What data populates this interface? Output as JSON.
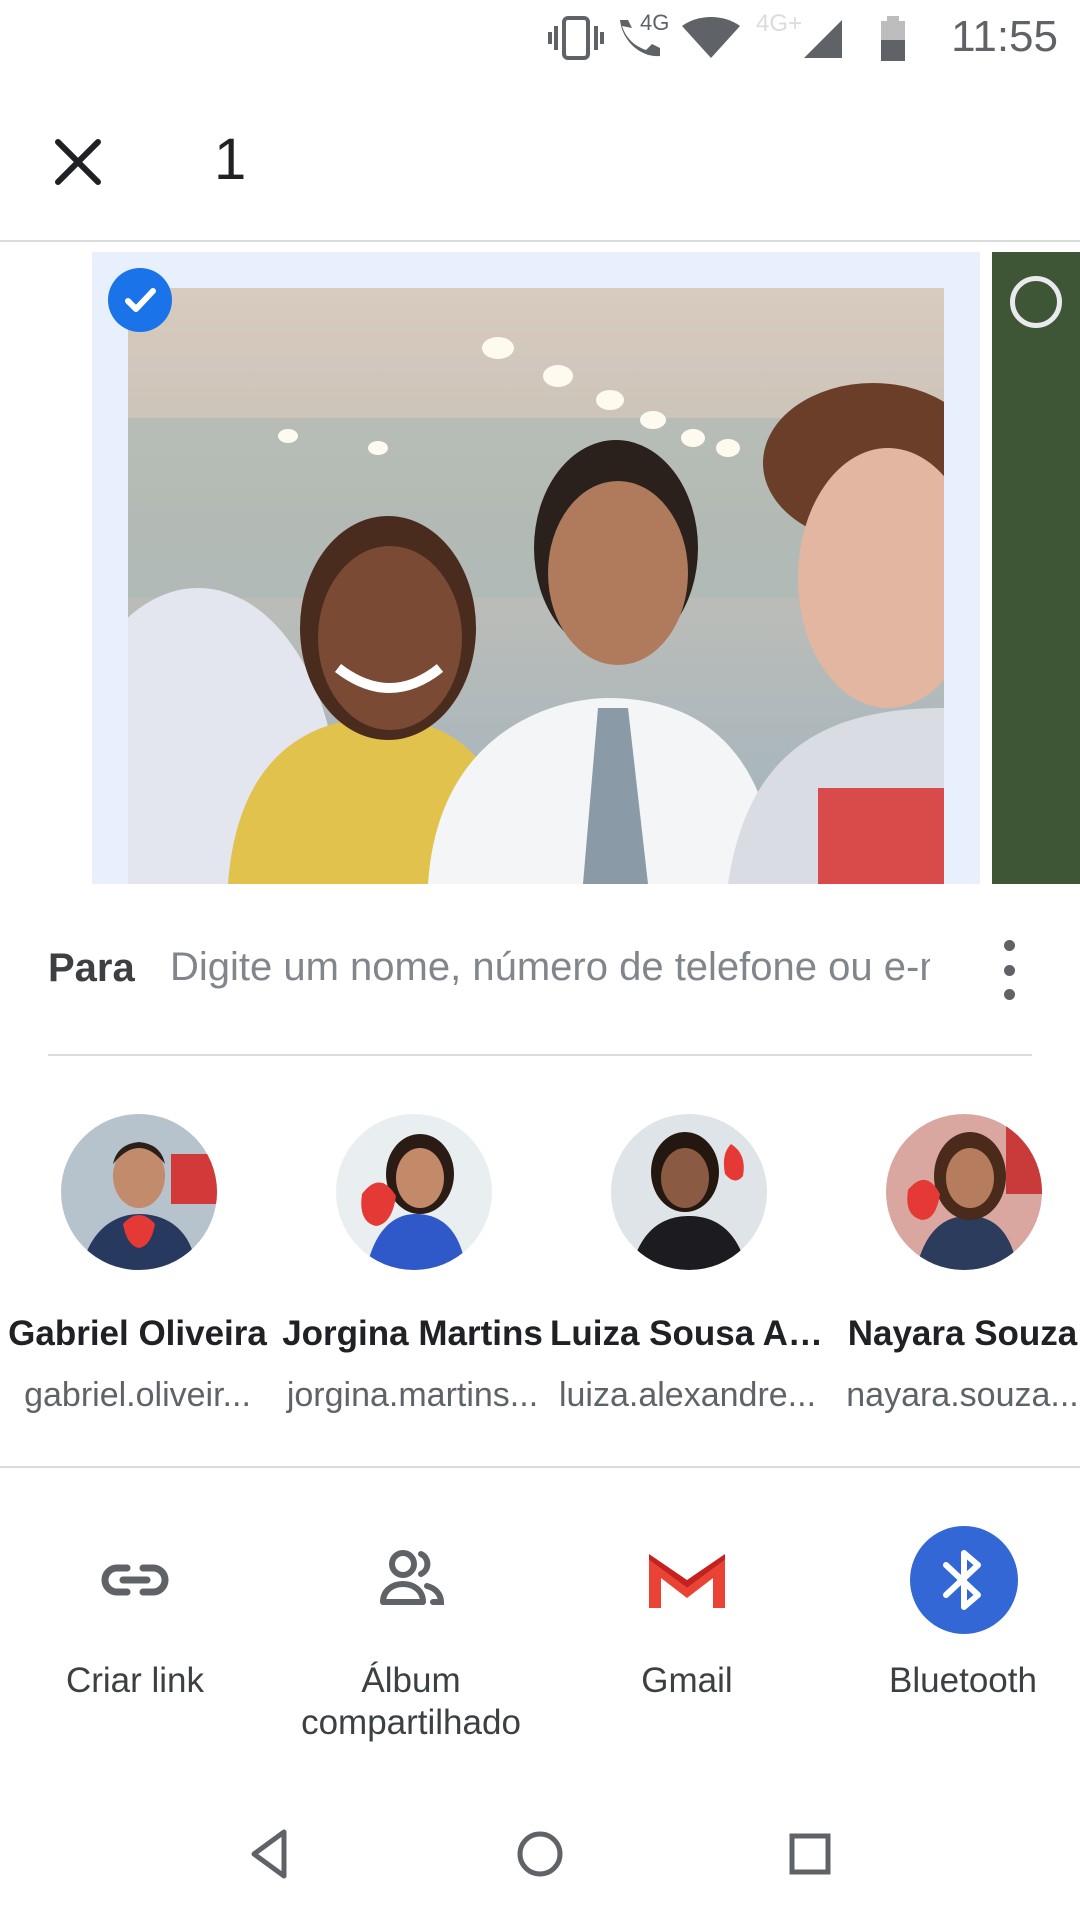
{
  "status_bar": {
    "time": "11:55",
    "network_label": "4G",
    "network_label_2": "4G+",
    "icons": [
      "vibrate-icon",
      "volte-call-icon",
      "wifi-icon",
      "cellular-signal-icon",
      "battery-icon"
    ]
  },
  "header": {
    "selected_count": "1",
    "close_icon": "close-icon"
  },
  "photos": {
    "selected_state": "checked",
    "next_state": "unchecked"
  },
  "share": {
    "to_label": "Para",
    "to_placeholder": "Digite um nome, número de telefone ou e-mail",
    "more_icon": "more-vert-icon"
  },
  "contacts": [
    {
      "name": "Gabriel Oliveira",
      "email": "gabriel.oliveir..."
    },
    {
      "name": "Jorgina Martins",
      "email": "jorgina.martins..."
    },
    {
      "name": "Luiza Sousa Ale...",
      "email": "luiza.alexandre..."
    },
    {
      "name": "Nayara Souza",
      "email": "nayara.souza..."
    }
  ],
  "apps": [
    {
      "label": "Criar link",
      "icon": "link-icon"
    },
    {
      "label": "Álbum compartilhado",
      "icon": "shared-album-icon"
    },
    {
      "label": "Gmail",
      "icon": "gmail-icon"
    },
    {
      "label": "Bluetooth",
      "icon": "bluetooth-icon"
    }
  ],
  "colors": {
    "accent": "#1a73e8",
    "selection_bg": "#e8f0fe",
    "bluetooth": "#3367d6",
    "gmail_red": "#ea4335"
  }
}
